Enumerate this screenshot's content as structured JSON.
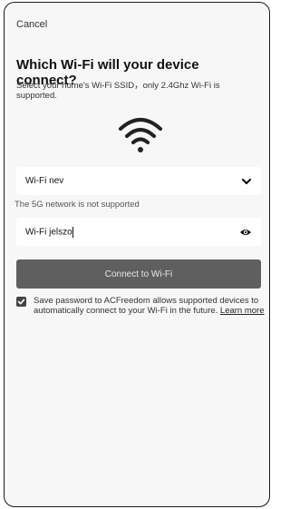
{
  "header": {
    "cancel_label": "Cancel"
  },
  "main": {
    "title": "Which Wi-Fi will your device connect?",
    "subtitle": "Select your home's Wi-Fi SSID，only 2.4Ghz Wi-Fi is supported.",
    "wifi_icon": "wifi-icon",
    "ssid_field": {
      "value": "Wi-Fi nev",
      "icon": "chevron-down-icon"
    },
    "network_warning": "The 5G network is not supported",
    "password_field": {
      "value": "Wi-Fi jelszo",
      "icon": "eye-icon"
    },
    "connect_button": "Connect to Wi-Fi",
    "save_password": {
      "checked": true,
      "text": "Save password to ACFreedom allows supported devices to automatically connect to your Wi-Fi in the future. ",
      "link": "Learn more"
    }
  },
  "colors": {
    "button_bg": "#5f5f5f",
    "checkbox": "#444444",
    "background": "#f7f7f7"
  }
}
